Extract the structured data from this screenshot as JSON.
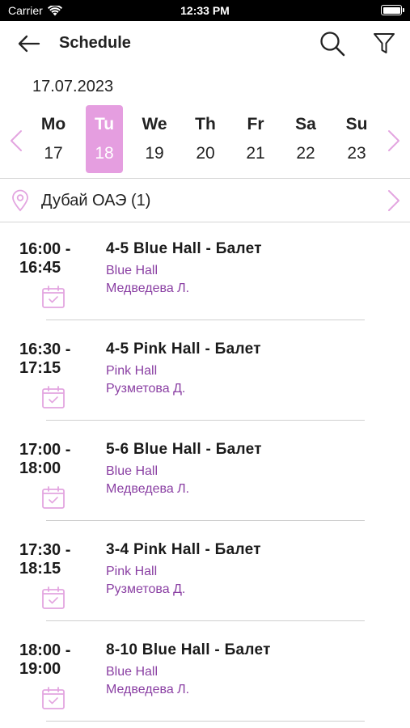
{
  "status_bar": {
    "carrier": "Carrier",
    "time": "12:33 PM"
  },
  "nav": {
    "title": "Schedule"
  },
  "date_label": "17.07.2023",
  "week": [
    {
      "name": "Mo",
      "num": "17",
      "selected": false
    },
    {
      "name": "Tu",
      "num": "18",
      "selected": true
    },
    {
      "name": "We",
      "num": "19",
      "selected": false
    },
    {
      "name": "Th",
      "num": "20",
      "selected": false
    },
    {
      "name": "Fr",
      "num": "21",
      "selected": false
    },
    {
      "name": "Sa",
      "num": "22",
      "selected": false
    },
    {
      "name": "Su",
      "num": "23",
      "selected": false
    }
  ],
  "location": {
    "label": "Дубай ОАЭ (1)"
  },
  "classes": [
    {
      "start": "16:00 -",
      "end": "16:45",
      "name": "4-5 Blue Hall - Балет",
      "hall": "Blue Hall",
      "teacher": "Медведева Л."
    },
    {
      "start": "16:30 -",
      "end": "17:15",
      "name": "4-5 Pink Hall - Балет",
      "hall": "Pink Hall",
      "teacher": "Рузметова Д."
    },
    {
      "start": "17:00 -",
      "end": "18:00",
      "name": "5-6 Blue Hall - Балет",
      "hall": "Blue Hall",
      "teacher": "Медведева Л."
    },
    {
      "start": "17:30 -",
      "end": "18:15",
      "name": "3-4 Pink Hall - Балет",
      "hall": "Pink Hall",
      "teacher": "Рузметова Д."
    },
    {
      "start": "18:00 -",
      "end": "19:00",
      "name": "8-10 Blue Hall - Балет",
      "hall": "Blue Hall",
      "teacher": "Медведева Л."
    }
  ],
  "colors": {
    "accent": "#e59ee0",
    "hall_text": "#8a3fa3",
    "arrow": "#e3a5e0"
  }
}
